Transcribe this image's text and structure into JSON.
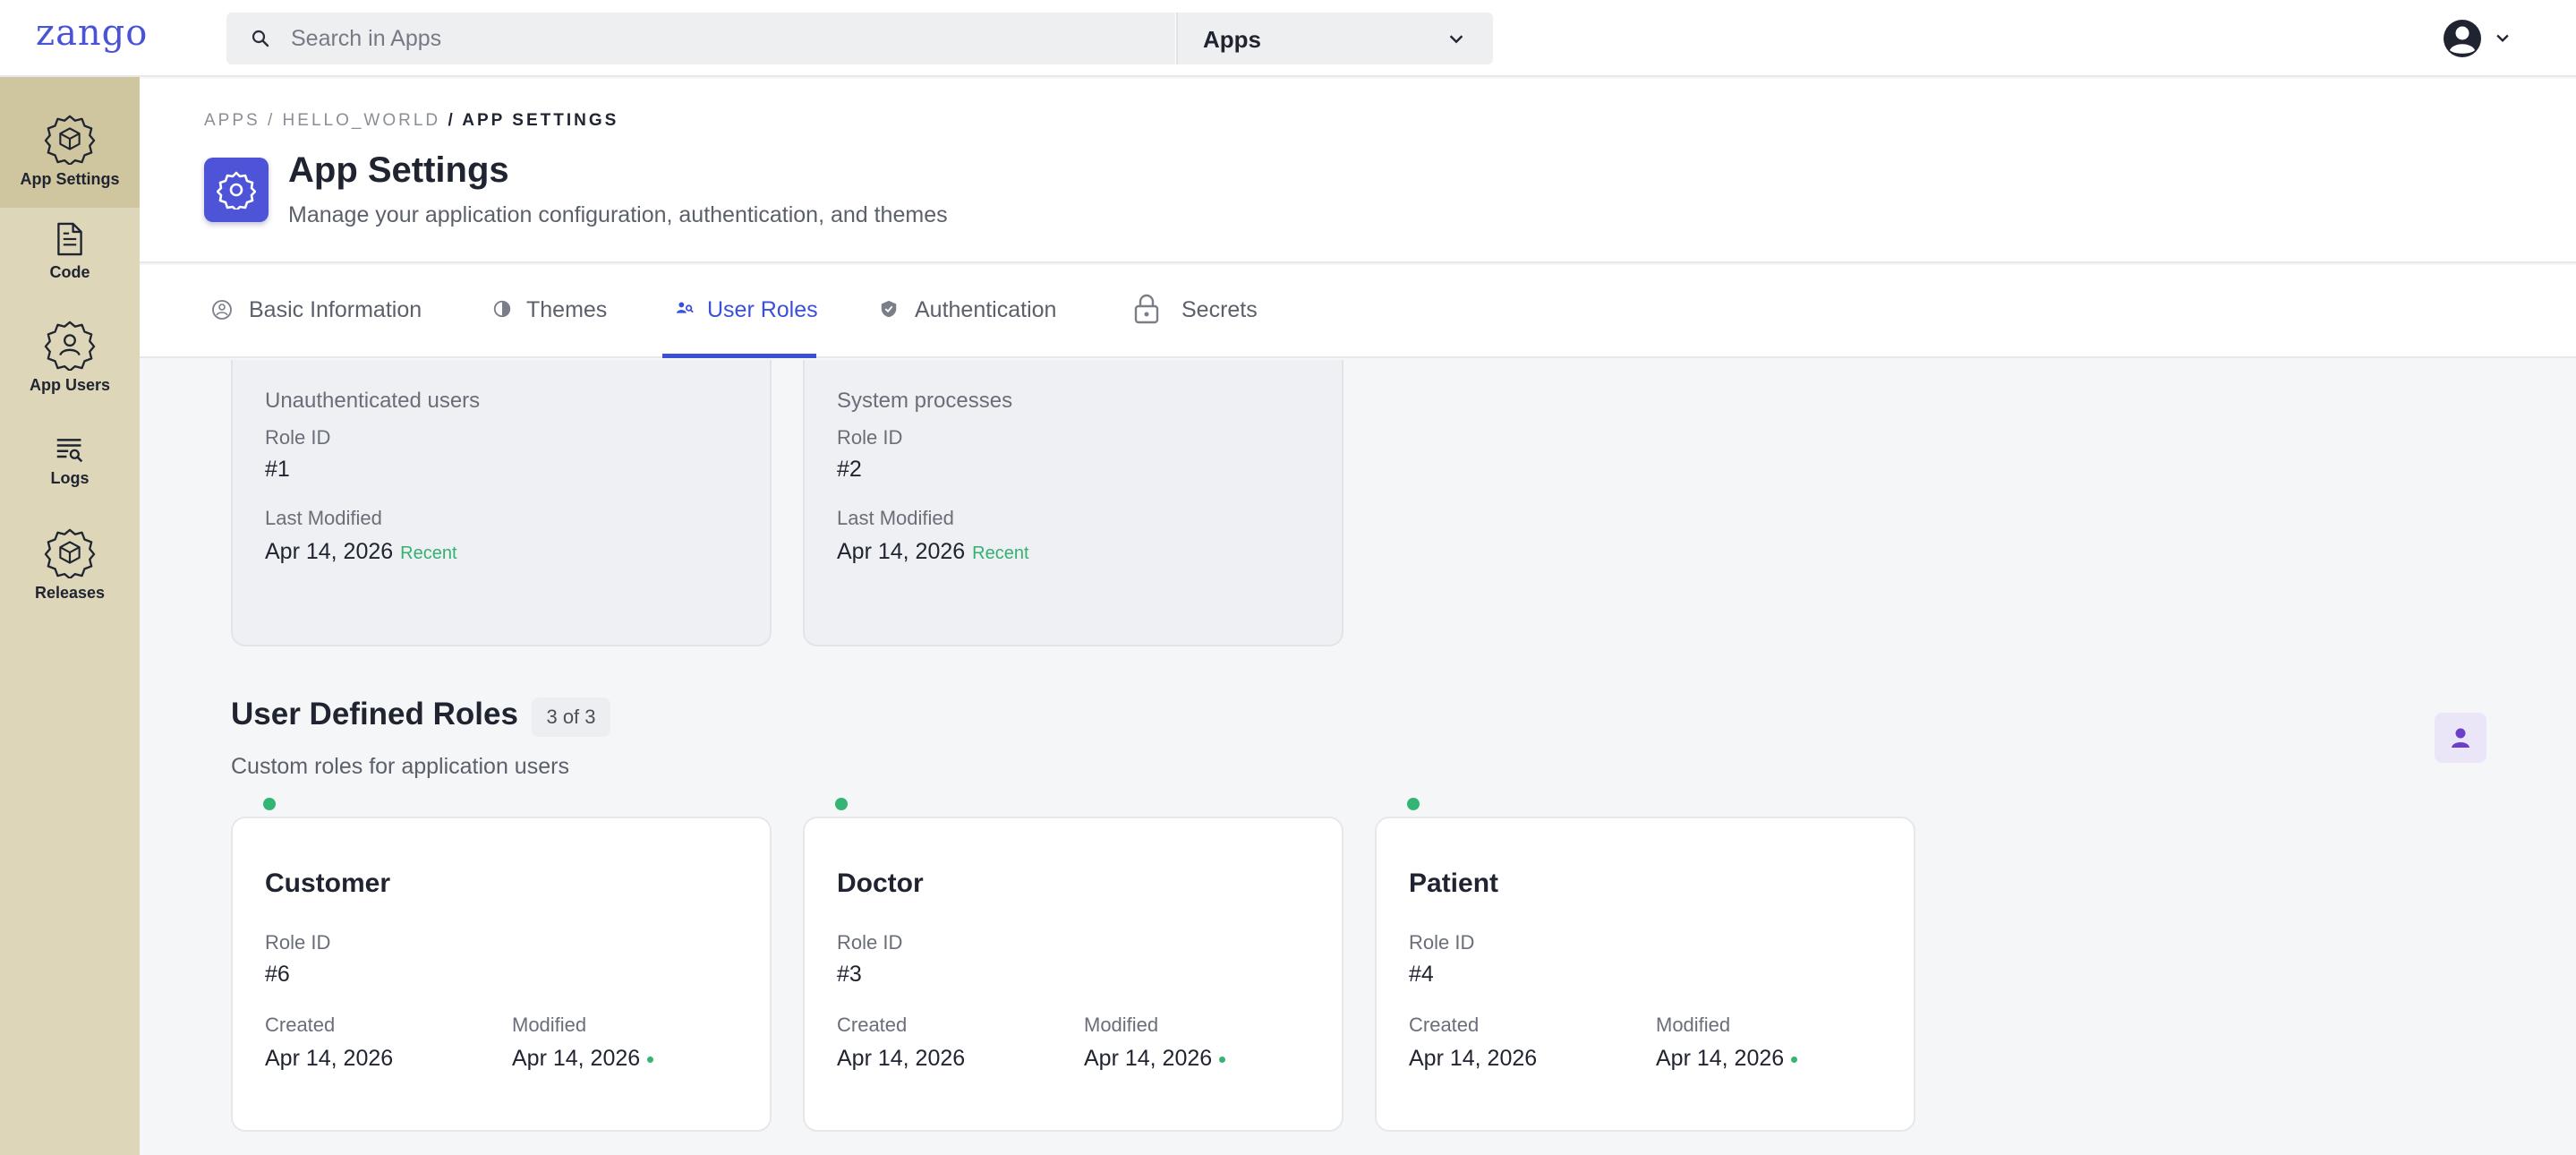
{
  "topbar": {
    "logo": "zango",
    "search_placeholder": "Search in Apps",
    "app_selector": "Apps"
  },
  "sidebar": {
    "items": [
      {
        "label": "App Settings",
        "icon": "settings-cube-icon",
        "active": true
      },
      {
        "label": "Code",
        "icon": "code-file-icon"
      },
      {
        "label": "App Users",
        "icon": "users-gear-icon"
      },
      {
        "label": "Logs",
        "icon": "logs-search-icon"
      },
      {
        "label": "Releases",
        "icon": "releases-cube-icon"
      }
    ]
  },
  "header": {
    "breadcrumb": {
      "apps": "APPS",
      "app": "HELLO_WORLD",
      "current": "/ APP SETTINGS",
      "sep": "/"
    },
    "title": "App Settings",
    "subtitle": "Manage your application configuration, authentication, and themes"
  },
  "tabs": [
    {
      "label": "Basic Information",
      "icon": "info-icon"
    },
    {
      "label": "Themes",
      "icon": "palette-icon"
    },
    {
      "label": "User Roles",
      "icon": "user-roles-icon",
      "active": true
    },
    {
      "label": "Authentication",
      "icon": "shield-icon"
    },
    {
      "label": "Secrets",
      "icon": "lock-icon"
    }
  ],
  "system_roles": [
    {
      "description": "Unauthenticated users",
      "role_id_label": "Role ID",
      "role_id": "#1",
      "modified_label": "Last Modified",
      "modified": "Apr 14, 2026",
      "badge": "Recent"
    },
    {
      "description": "System processes",
      "role_id_label": "Role ID",
      "role_id": "#2",
      "modified_label": "Last Modified",
      "modified": "Apr 14, 2026",
      "badge": "Recent"
    }
  ],
  "user_defined": {
    "title": "User Defined Roles",
    "count": "3 of 3",
    "subtitle": "Custom roles for application users",
    "roles": [
      {
        "name": "Customer",
        "role_id_label": "Role ID",
        "role_id": "#6",
        "created_label": "Created",
        "created": "Apr 14, 2026",
        "modified_label": "Modified",
        "modified": "Apr 14, 2026"
      },
      {
        "name": "Doctor",
        "role_id_label": "Role ID",
        "role_id": "#3",
        "created_label": "Created",
        "created": "Apr 14, 2026",
        "modified_label": "Modified",
        "modified": "Apr 14, 2026"
      },
      {
        "name": "Patient",
        "role_id_label": "Role ID",
        "role_id": "#4",
        "created_label": "Created",
        "created": "Apr 14, 2026",
        "modified_label": "Modified",
        "modified": "Apr 14, 2026"
      }
    ]
  },
  "colors": {
    "accent": "#3b50d6",
    "sidebar": "#ddd6b8",
    "status_green": "#35b573"
  }
}
